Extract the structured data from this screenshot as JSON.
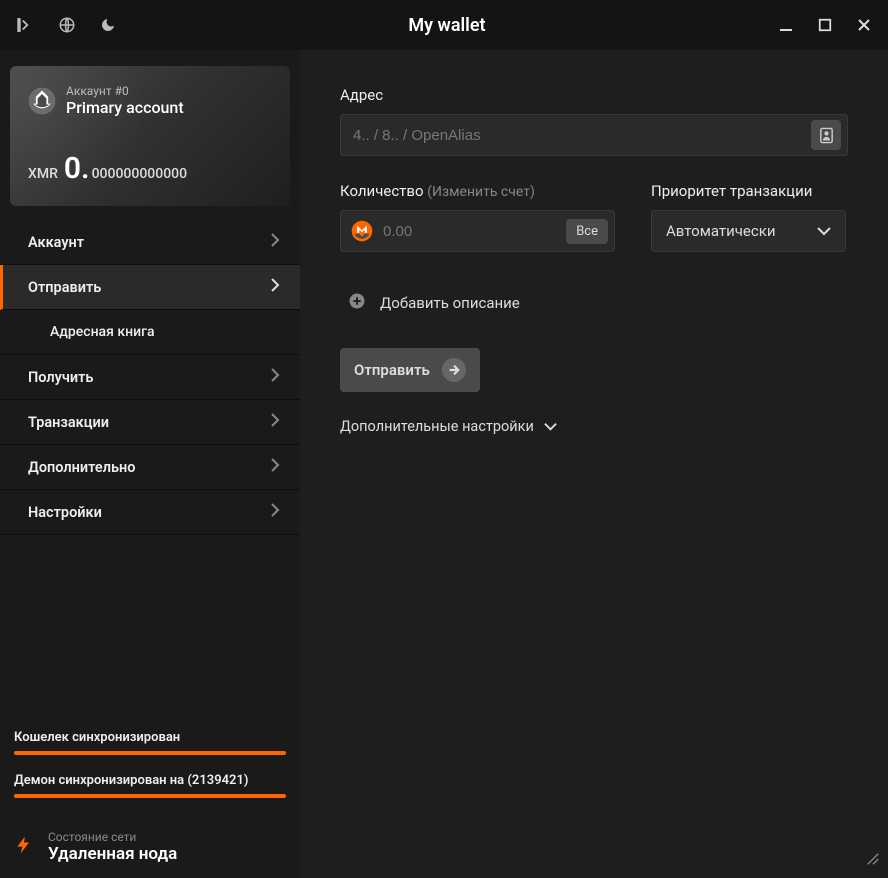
{
  "titlebar": {
    "title": "My wallet"
  },
  "account": {
    "num_label": "Аккаунт #0",
    "name": "Primary account",
    "currency": "XMR",
    "balance_major": "0.",
    "balance_minor": "000000000000"
  },
  "nav": {
    "account": "Аккаунт",
    "send": "Отправить",
    "addressbook": "Адресная книга",
    "receive": "Получить",
    "transactions": "Транзакции",
    "advanced": "Дополнительно",
    "settings": "Настройки"
  },
  "sync": {
    "wallet_label": "Кошелек синхронизирован",
    "daemon_label": "Демон синхронизирован на (2139421)"
  },
  "network": {
    "label": "Состояние сети",
    "value": "Удаленная нода"
  },
  "form": {
    "address_label": "Адрес",
    "address_placeholder": "4.. / 8.. / OpenAlias",
    "amount_label": "Количество",
    "amount_sublabel": "(Изменить счет)",
    "amount_placeholder": "0.00",
    "all_button": "Все",
    "priority_label": "Приоритет транзакции",
    "priority_value": "Автоматически",
    "add_desc": "Добавить описание",
    "send_button": "Отправить",
    "advanced_settings": "Дополнительные настройки"
  }
}
